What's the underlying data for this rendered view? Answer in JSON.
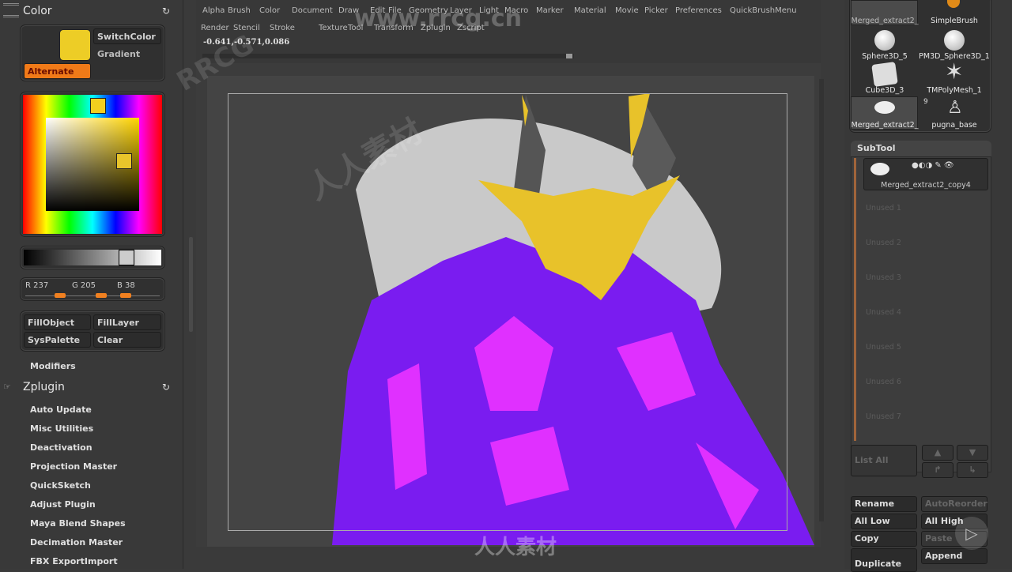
{
  "color_panel": {
    "title": "Color",
    "switch_color": "SwitchColor",
    "gradient": "Gradient",
    "alternate": "Alternate",
    "main_color": "#EDCD26",
    "r_label": "R 237",
    "g_label": "G 205",
    "b_label": "B 38",
    "r": 237,
    "g": 205,
    "b": 38,
    "fill_object": "FillObject",
    "fill_layer": "FillLayer",
    "sys_palette": "SysPalette",
    "clear": "Clear",
    "modifiers": "Modifiers"
  },
  "zplugin": {
    "title": "Zplugin",
    "items": [
      "Auto Update",
      "Misc Utilities",
      "Deactivation",
      "Projection Master",
      "QuickSketch",
      "Adjust Plugin",
      "Maya Blend Shapes",
      "Decimation Master",
      "FBX ExportImport"
    ]
  },
  "menu": {
    "row1": [
      "Alpha",
      "Brush",
      "Color",
      "Document",
      "Draw",
      "Edit",
      "File",
      "Geometry",
      "Layer",
      "Light",
      "Macro",
      "Marker",
      "Material",
      "Movie",
      "Picker",
      "Preferences",
      "QuickBrushMenu"
    ],
    "row2": [
      "Render",
      "Stencil",
      "Stroke",
      "Texture",
      "Tool",
      "Transform",
      "Zplugin",
      "Zscript"
    ],
    "coords": "-0.641,-0.571,0.086"
  },
  "tools": {
    "items": [
      "Merged_extract2_",
      "SimpleBrush",
      "Sphere3D_5",
      "PM3D_Sphere3D_1",
      "Cube3D_3",
      "TMPolyMesh_1",
      "Merged_extract2_",
      "pugna_base"
    ],
    "count_badge": "9"
  },
  "subtool": {
    "title": "SubTool",
    "active": "Merged_extract2_copy4",
    "unused": [
      "Unused 1",
      "Unused 2",
      "Unused 3",
      "Unused 4",
      "Unused 5",
      "Unused 6",
      "Unused 7"
    ],
    "list_all": "List All",
    "rename": "Rename",
    "auto_reorder": "AutoReorder",
    "all_low": "All Low",
    "all_high": "All High",
    "copy": "Copy",
    "paste": "Paste",
    "duplicate": "Duplicate",
    "append": "Append"
  },
  "watermark": {
    "site": "www.rrcg.cn",
    "brand": "RRCG",
    "cn": "人人素材"
  },
  "colors": {
    "purple": "#7a1cf0",
    "magenta": "#e030ff",
    "gold": "#e8c22a",
    "bone": "#cfcfcf",
    "horn": "#555"
  }
}
